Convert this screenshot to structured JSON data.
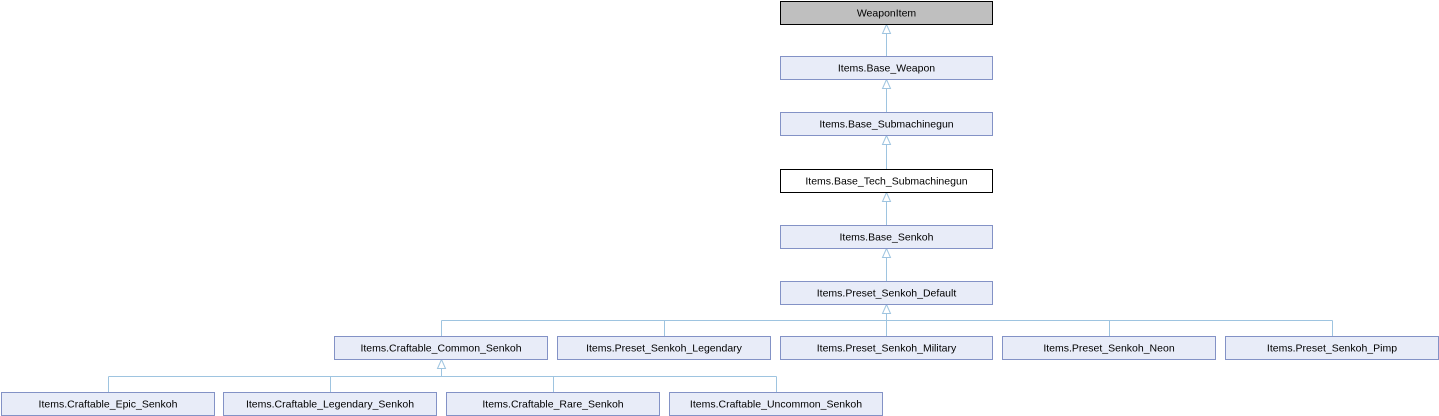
{
  "diagram": {
    "colors": {
      "root_fill": "#bfbfbf",
      "root_stroke": "#000000",
      "current_fill": "#ffffff",
      "current_stroke": "#000000",
      "class_fill": "#e8ecf8",
      "class_stroke": "#8392c6",
      "edge": "#9ec4e0"
    },
    "nodes": [
      {
        "id": "weaponitem",
        "label": "WeaponItem",
        "kind": "root"
      },
      {
        "id": "base-weapon",
        "label": "Items.Base_Weapon",
        "kind": "class"
      },
      {
        "id": "base-submachinegun",
        "label": "Items.Base_Submachinegun",
        "kind": "class"
      },
      {
        "id": "base-tech-submachinegun",
        "label": "Items.Base_Tech_Submachinegun",
        "kind": "current"
      },
      {
        "id": "base-senkoh",
        "label": "Items.Base_Senkoh",
        "kind": "class"
      },
      {
        "id": "preset-senkoh-default",
        "label": "Items.Preset_Senkoh_Default",
        "kind": "class"
      },
      {
        "id": "craftable-common-senkoh",
        "label": "Items.Craftable_Common_Senkoh",
        "kind": "class"
      },
      {
        "id": "preset-senkoh-legendary",
        "label": "Items.Preset_Senkoh_Legendary",
        "kind": "class"
      },
      {
        "id": "preset-senkoh-military",
        "label": "Items.Preset_Senkoh_Military",
        "kind": "class"
      },
      {
        "id": "preset-senkoh-neon",
        "label": "Items.Preset_Senkoh_Neon",
        "kind": "class"
      },
      {
        "id": "preset-senkoh-pimp",
        "label": "Items.Preset_Senkoh_Pimp",
        "kind": "class"
      },
      {
        "id": "craftable-epic-senkoh",
        "label": "Items.Craftable_Epic_Senkoh",
        "kind": "class"
      },
      {
        "id": "craftable-legendary-senkoh",
        "label": "Items.Craftable_Legendary_Senkoh",
        "kind": "class"
      },
      {
        "id": "craftable-rare-senkoh",
        "label": "Items.Craftable_Rare_Senkoh",
        "kind": "class"
      },
      {
        "id": "craftable-uncommon-senkoh",
        "label": "Items.Craftable_Uncommon_Senkoh",
        "kind": "class"
      }
    ],
    "edges": [
      {
        "parent": "weaponitem",
        "children": [
          "base-weapon"
        ]
      },
      {
        "parent": "base-weapon",
        "children": [
          "base-submachinegun"
        ]
      },
      {
        "parent": "base-submachinegun",
        "children": [
          "base-tech-submachinegun"
        ]
      },
      {
        "parent": "base-tech-submachinegun",
        "children": [
          "base-senkoh"
        ]
      },
      {
        "parent": "base-senkoh",
        "children": [
          "preset-senkoh-default"
        ]
      },
      {
        "parent": "preset-senkoh-default",
        "children": [
          "craftable-common-senkoh",
          "preset-senkoh-legendary",
          "preset-senkoh-military",
          "preset-senkoh-neon",
          "preset-senkoh-pimp"
        ]
      },
      {
        "parent": "craftable-common-senkoh",
        "children": [
          "craftable-epic-senkoh",
          "craftable-legendary-senkoh",
          "craftable-rare-senkoh",
          "craftable-uncommon-senkoh"
        ]
      }
    ]
  }
}
